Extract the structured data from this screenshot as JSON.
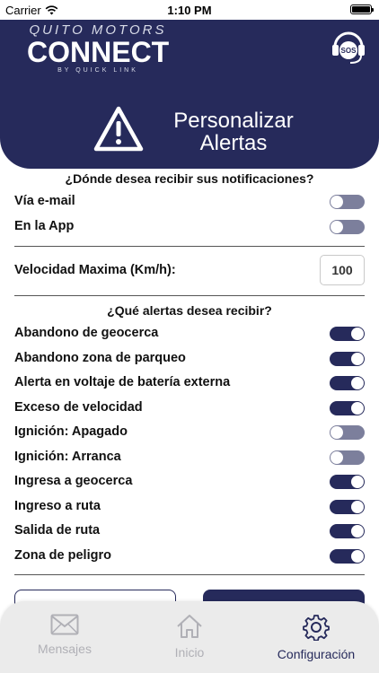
{
  "status_bar": {
    "carrier": "Carrier",
    "time": "1:10 PM"
  },
  "header": {
    "brand_top": "QUITO MOTORS",
    "brand_main": "CONNECT",
    "brand_sub": "BY QUICK LINK",
    "sos_label": "SOS",
    "sos_icon": "headset-sos-icon"
  },
  "banner": {
    "title": "Personalizar Alertas",
    "icon": "warning-icon"
  },
  "notifications": {
    "heading": "¿Dónde desea recibir sus notificaciones?",
    "options": [
      {
        "label": "Vía e-mail",
        "enabled": false
      },
      {
        "label": "En la App",
        "enabled": false
      }
    ]
  },
  "speed": {
    "label": "Velocidad Maxima (Km/h):",
    "value": "100"
  },
  "alerts": {
    "heading": "¿Qué alertas desea recibir?",
    "items": [
      {
        "label": "Abandono de geocerca",
        "enabled": true
      },
      {
        "label": "Abandono zona de parqueo",
        "enabled": true
      },
      {
        "label": "Alerta en voltaje de batería externa",
        "enabled": true
      },
      {
        "label": "Exceso de velocidad",
        "enabled": true
      },
      {
        "label": "Ignición: Apagado",
        "enabled": false
      },
      {
        "label": "Ignición: Arranca",
        "enabled": false
      },
      {
        "label": "Ingresa a geocerca",
        "enabled": true
      },
      {
        "label": "Ingreso a ruta",
        "enabled": true
      },
      {
        "label": "Salida de ruta",
        "enabled": true
      },
      {
        "label": "Zona de peligro",
        "enabled": true
      }
    ]
  },
  "tabbar": {
    "tabs": [
      {
        "label": "Mensajes",
        "icon": "envelope-icon",
        "active": false
      },
      {
        "label": "Inicio",
        "icon": "home-icon",
        "active": false
      },
      {
        "label": "Configuración",
        "icon": "gear-icon",
        "active": true
      }
    ]
  },
  "colors": {
    "primary": "#262a5b",
    "toggle_off": "#7c7f9c",
    "tabbar_bg": "#ebebeb",
    "inactive_tab": "#b0b0b6"
  }
}
